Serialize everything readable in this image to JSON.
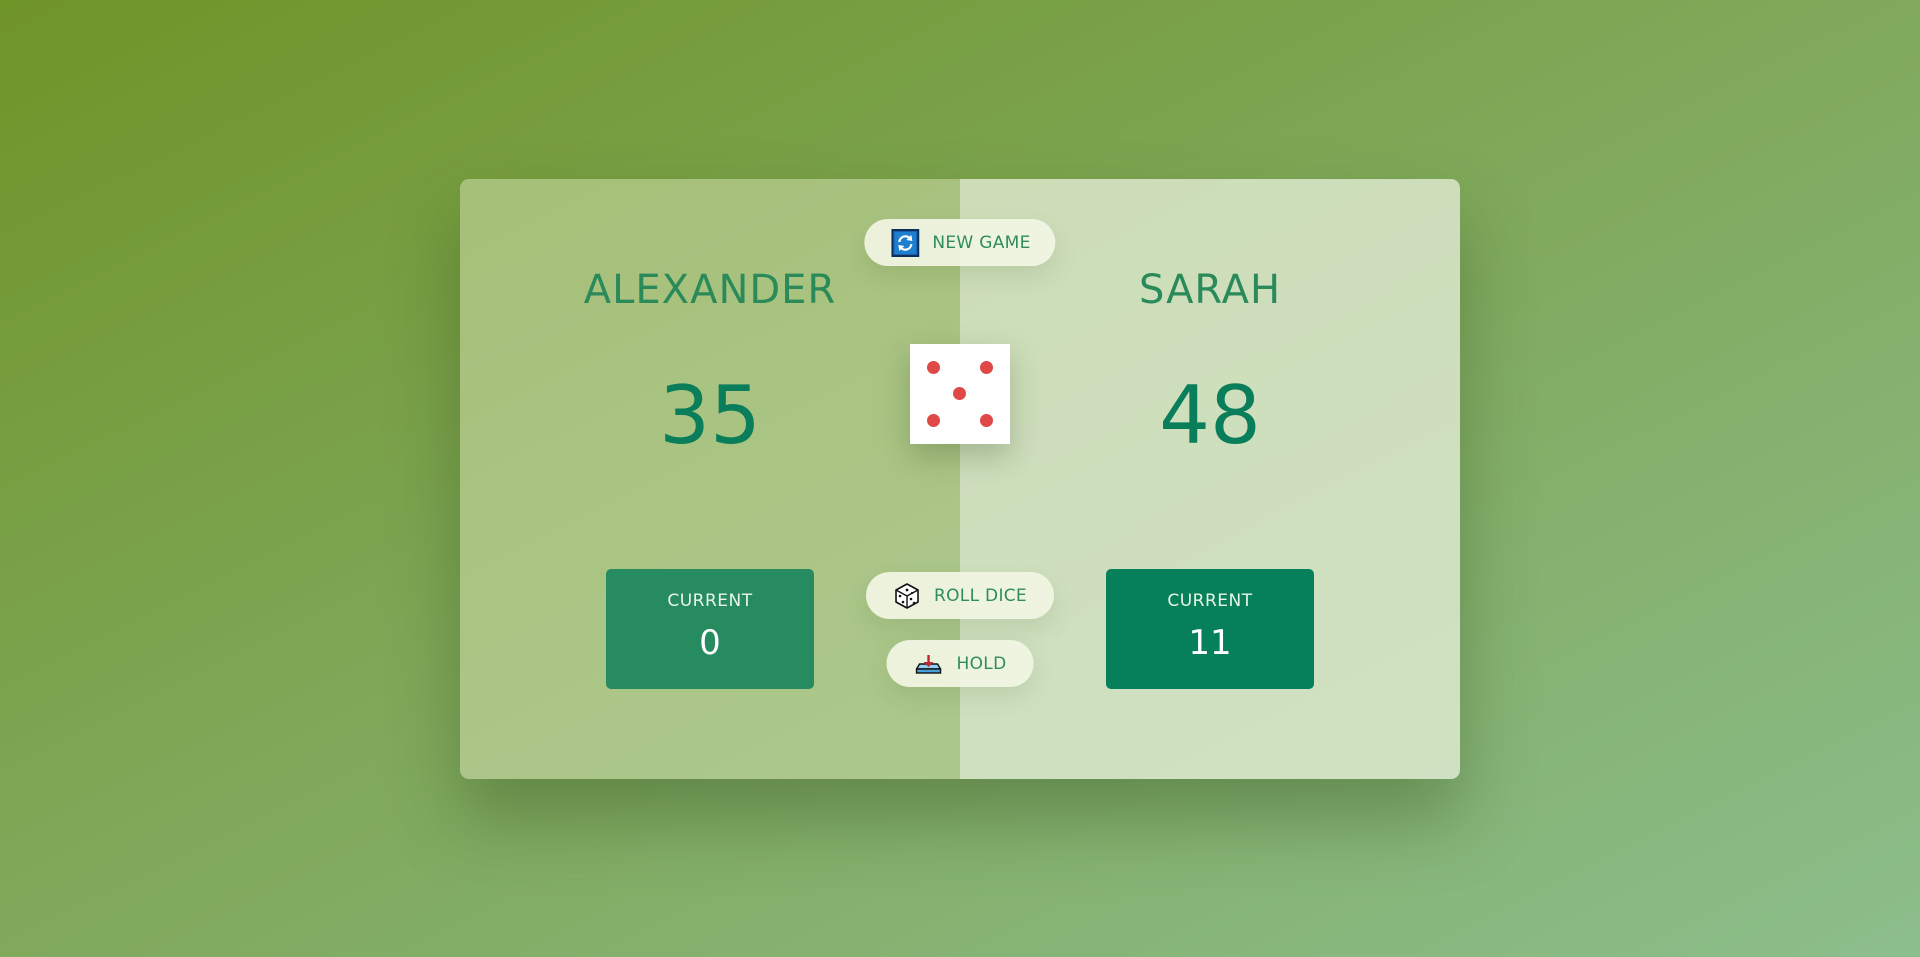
{
  "players": [
    {
      "name": "ALEXANDER",
      "score": "35",
      "current_label": "CURRENT",
      "current_score": "0"
    },
    {
      "name": "SARAH",
      "score": "48",
      "current_label": "CURRENT",
      "current_score": "11"
    }
  ],
  "buttons": {
    "new_game": {
      "label": "NEW GAME",
      "icon": "refresh-icon"
    },
    "roll_dice": {
      "label": "ROLL DICE",
      "icon": "dice-icon"
    },
    "hold": {
      "label": "HOLD",
      "icon": "hold-icon"
    }
  },
  "dice": {
    "value": 5
  },
  "colors": {
    "accent": "#2a8a5a",
    "score": "#0a7e5a",
    "current_left": "#278b60",
    "current_right": "#06805b",
    "pip": "#e04848"
  }
}
